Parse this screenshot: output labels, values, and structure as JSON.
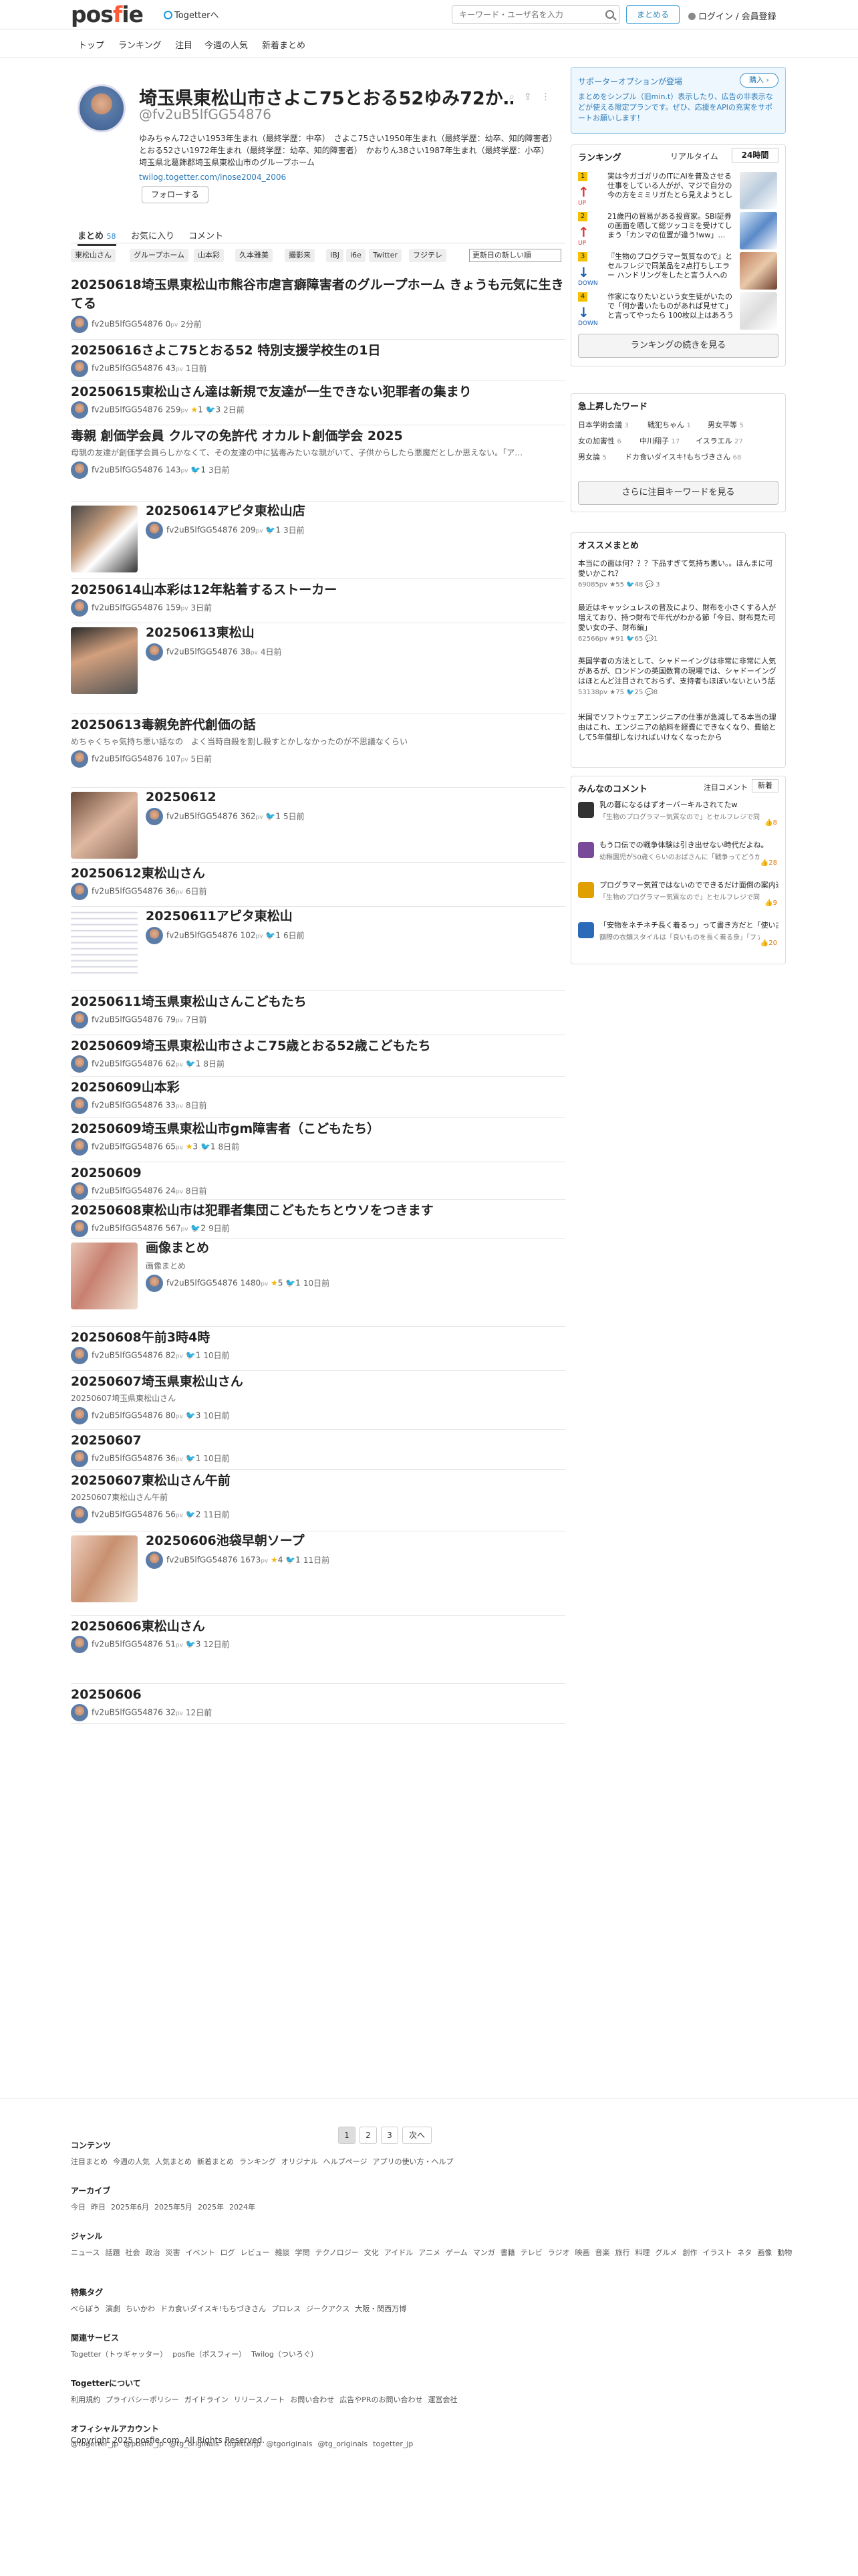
{
  "header": {
    "logo": "posfie",
    "togetter": "Togetterへ",
    "search_placeholder": "キーワード・ユーザ名を入力",
    "create_label": "まとめる",
    "login_label": "ログイン / 会員登録"
  },
  "nav": [
    "トップ",
    "ランキング",
    "注目",
    "今週の人気",
    "新着まとめ"
  ],
  "profile": {
    "name": "埼玉県東松山市さよこ75とおる52ゆみ72か…",
    "handle": "@fv2uB5lfGG54876",
    "description": "ゆみちゃん72さい1953年生まれ（最終学歴：中卒）　さよこ75さい1950年生まれ（最終学歴：幼卒、知的障害者）　とおる52さい1972年生まれ（最終学歴：幼卒、知的障害者）　かおりん38さい1987年生まれ（最終学歴：小卒）　埼玉県北葛飾郡埼玉県東松山市のグループホーム",
    "link": "twilog.togetter.com/inose2004_2006",
    "follow_label": "フォローする"
  },
  "tabs": [
    {
      "label": "まとめ",
      "count": "58"
    },
    {
      "label": "お気に入り",
      "count": ""
    },
    {
      "label": "コメント",
      "count": ""
    }
  ],
  "tags": [
    "東松山さん",
    "グループホーム",
    "山本彩",
    "久本雅美",
    "撮影来",
    "IBJ",
    "i6e",
    "Twitter",
    "フジテレ"
  ],
  "sort_label": "更新日の新しい順",
  "items": [
    {
      "title": "20250618埼玉県東松山市熊谷市虐言癖障害者のグループホーム きょうも元気に生きてる",
      "desc": "",
      "user": "fv2uB5lfGG54876",
      "views": "0",
      "unit": "pv",
      "stars": "",
      "tw": "",
      "time": "2分前"
    },
    {
      "title": "20250616さよこ75とおる52 特別支援学校生の1日",
      "desc": "",
      "user": "fv2uB5lfGG54876",
      "views": "43",
      "unit": "pv",
      "stars": "",
      "tw": "",
      "time": "1日前"
    },
    {
      "title": "20250615東松山さん達は新規で友達が一生できない犯罪者の集まり",
      "desc": "",
      "user": "fv2uB5lfGG54876",
      "views": "259",
      "unit": "pv",
      "stars": "1",
      "tw": "3",
      "time": "2日前"
    },
    {
      "title": "毒親 創価学会員 クルマの免許代 オカルト創価学会 2025",
      "desc": "母親の友達が創価学会員らしかなくて、その友達の中に猛毒みたいな親がいて、子供からしたら悪魔だとしか思えない。「ア…",
      "user": "fv2uB5lfGG54876",
      "views": "143",
      "unit": "pv",
      "stars": "",
      "tw": "1",
      "time": "3日前"
    },
    {
      "title": "20250614アピタ東松山店",
      "desc": "",
      "user": "fv2uB5lfGG54876",
      "views": "209",
      "unit": "pv",
      "stars": "",
      "tw": "1",
      "time": "3日前"
    },
    {
      "title": "20250614山本彩は12年粘着するストーカー",
      "desc": "",
      "user": "fv2uB5lfGG54876",
      "views": "159",
      "unit": "pv",
      "stars": "",
      "tw": "",
      "time": "3日前"
    },
    {
      "title": "20250613東松山",
      "desc": "",
      "user": "fv2uB5lfGG54876",
      "views": "38",
      "unit": "pv",
      "stars": "",
      "tw": "",
      "time": "4日前"
    },
    {
      "title": "20250613毒親免許代創価の話",
      "desc": "めちゃくちゃ気持ち悪い話なの　よく当時自殺を割し殺すとかしなかったのが不思議なくらい",
      "user": "fv2uB5lfGG54876",
      "views": "107",
      "unit": "pv",
      "stars": "",
      "tw": "",
      "time": "5日前"
    },
    {
      "title": "20250612",
      "desc": "",
      "user": "fv2uB5lfGG54876",
      "views": "362",
      "unit": "pv",
      "stars": "",
      "tw": "1",
      "time": "5日前"
    },
    {
      "title": "20250612東松山さん",
      "desc": "",
      "user": "fv2uB5lfGG54876",
      "views": "36",
      "unit": "pv",
      "stars": "",
      "tw": "",
      "time": "6日前"
    },
    {
      "title": "20250611アピタ東松山",
      "desc": "",
      "user": "fv2uB5lfGG54876",
      "views": "102",
      "unit": "pv",
      "stars": "",
      "tw": "1",
      "time": "6日前"
    },
    {
      "title": "20250611埼玉県東松山さんこどもたち",
      "desc": "",
      "user": "fv2uB5lfGG54876",
      "views": "79",
      "unit": "pv",
      "stars": "",
      "tw": "",
      "time": "7日前"
    },
    {
      "title": "20250609埼玉県東松山市さよこ75歳とおる52歳こどもたち",
      "desc": "",
      "user": "fv2uB5lfGG54876",
      "views": "62",
      "unit": "pv",
      "stars": "",
      "tw": "1",
      "time": "8日前"
    },
    {
      "title": "20250609山本彩",
      "desc": "",
      "user": "fv2uB5lfGG54876",
      "views": "33",
      "unit": "pv",
      "stars": "",
      "tw": "",
      "time": "8日前"
    },
    {
      "title": "20250609埼玉県東松山市gm障害者（こどもたち）",
      "desc": "",
      "user": "fv2uB5lfGG54876",
      "views": "65",
      "unit": "pv",
      "stars": "3",
      "tw": "1",
      "time": "8日前"
    },
    {
      "title": "20250609",
      "desc": "",
      "user": "fv2uB5lfGG54876",
      "views": "24",
      "unit": "pv",
      "stars": "",
      "tw": "",
      "time": "8日前"
    },
    {
      "title": "20250608東松山市は犯罪者集団こどもたちとウソをつきます",
      "desc": "",
      "user": "fv2uB5lfGG54876",
      "views": "567",
      "unit": "pv",
      "stars": "",
      "tw": "2",
      "time": "9日前"
    },
    {
      "title": "画像まとめ",
      "desc": "画像まとめ",
      "user": "fv2uB5lfGG54876",
      "views": "1480",
      "unit": "pv",
      "stars": "5",
      "tw": "1",
      "time": "10日前"
    },
    {
      "title": "20250608午前3時4時",
      "desc": "",
      "user": "fv2uB5lfGG54876",
      "views": "82",
      "unit": "pv",
      "stars": "",
      "tw": "1",
      "time": "10日前"
    },
    {
      "title": "20250607埼玉県東松山さん",
      "desc": "20250607埼玉県東松山さん",
      "user": "fv2uB5lfGG54876",
      "views": "80",
      "unit": "pv",
      "stars": "",
      "tw": "3",
      "time": "10日前"
    },
    {
      "title": "20250607",
      "desc": "",
      "user": "fv2uB5lfGG54876",
      "views": "36",
      "unit": "pv",
      "stars": "",
      "tw": "1",
      "time": "10日前"
    },
    {
      "title": "20250607東松山さん午前",
      "desc": "20250607東松山さん午前",
      "user": "fv2uB5lfGG54876",
      "views": "56",
      "unit": "pv",
      "stars": "",
      "tw": "2",
      "time": "11日前"
    },
    {
      "title": "20250606池袋早朝ソープ",
      "desc": "",
      "user": "fv2uB5lfGG54876",
      "views": "1673",
      "unit": "pv",
      "stars": "4",
      "tw": "1",
      "time": "11日前"
    },
    {
      "title": "20250606東松山さん",
      "desc": "",
      "user": "fv2uB5lfGG54876",
      "views": "51",
      "unit": "pv",
      "stars": "",
      "tw": "3",
      "time": "12日前"
    },
    {
      "title": "20250606",
      "desc": "",
      "user": "fv2uB5lfGG54876",
      "views": "32",
      "unit": "pv",
      "stars": "",
      "tw": "",
      "time": "12日前"
    }
  ],
  "pager": [
    "1",
    "2",
    "3",
    "次へ"
  ],
  "sidebar": {
    "support": {
      "title": "サポーターオプションが登場",
      "button": "購入 ›",
      "text": "まとめをシンプル（旧min.t）表示したり、広告の非表示などが使える限定プランです。ぜひ、応援をAPIの充実をサポートお願いします！"
    },
    "ranking": {
      "title": "ランキング",
      "tab_realtime": "リアルタイム",
      "tab_24h": "24時間",
      "items": [
        {
          "num": "1",
          "dir": "UP",
          "text": "実は今ガゴガリのITにAIを普及させる仕事をしている人がが、マジで自分の今の方をミミリガたとら見えようとしない七の方と思っても見合を…"
        },
        {
          "num": "2",
          "dir": "UP",
          "text": "21歳円の貿易がある投資家。SBI証券の画面を晒して総ツッコミを受けてしまう「カンマの位置が違う!ww」…"
        },
        {
          "num": "3",
          "dir": "DOWN",
          "text": "『生物のプログラマー気質なので』とセルフレジで同業品を2点打ちしエラー ハンドリングをしたと言う人への反…"
        },
        {
          "num": "4",
          "dir": "DOWN",
          "text": "作家になりたいという女生徒がいたので「何か書いたものがあれば見せて」と言ってやったら 100枚以上はあろうかという A4の紙を渡され…"
        }
      ],
      "button": "ランキングの続きを見る"
    },
    "trending": {
      "title": "急上昇したワード",
      "words": [
        {
          "w": "日本学術会議",
          "n": "3"
        },
        {
          "w": "戦犯ちゃん",
          "n": "1"
        },
        {
          "w": "男女平等",
          "n": "5"
        },
        {
          "w": "女の加害性",
          "n": "6"
        },
        {
          "w": "中川翔子",
          "n": "17"
        },
        {
          "w": "イスラエル",
          "n": "27"
        },
        {
          "w": "男女論",
          "n": "5"
        },
        {
          "w": "ドカ食いダイスキ!もちづきさん",
          "n": "68"
        }
      ],
      "button": "さらに注目キーワードを見る"
    },
    "recommend": {
      "title": "オススメまとめ",
      "items": [
        {
          "text": "本当にの面は何？？？下品すぎて気持ち悪い。。ほんまに可愛いかこれ？",
          "meta": "69085pv ★55 🐦48 💬 3"
        },
        {
          "text": "最近はキャッシュレスの普及により、財布を小さくする人が増えており、持つ財布で年代がわかる節「今日、財布見た可愛い女の子、財布編」",
          "meta": "62566pv ★91 🐦65 💬1"
        },
        {
          "text": "英国学者の方法として、シャドーイングは非常に非常に人気があるが、ロンドンの英国数育の現場では、シャドーイングはほとんど注目されておらず、支持者もほぼいないという話",
          "meta": "53138pv ★75 🐦25 💬8"
        },
        {
          "text": "米国でソフトウェアエンジニアの仕事が急減してる本当の理由はこれ、エンジニアの給料を経費にできなくなり、費給として5年償却しなければいけなくなったから",
          "meta": ""
        }
      ]
    },
    "comments": {
      "title": "みんなのコメント",
      "tab_attention": "注目コメント",
      "tab_new": "新着",
      "items": [
        {
          "title": "乳の暮になるはずオーバーキルされてたw",
          "sub": "「生物のプログラマー気質なので」とセルフレジで同…",
          "likes": "8"
        },
        {
          "title": "もう口伝での戦争体験は引き出せない時代だよね。",
          "sub": "幼稚園児が50歳くらいのおばさんに「戦争ってどうか…",
          "likes": "28"
        },
        {
          "title": "プログラマー気質ではないのでできるだけ面倒の案内通りに操作してアテークスのバグ踏まな…",
          "sub": "「生物のプログラマー気質なので」とセルフレジで同…",
          "likes": "9"
        },
        {
          "title": "「安物をネチネチ長く着るっ」って書き方だと「使い古したタオルは捨てずに雑巾にする」的な…",
          "sub": "額際の衣類スタイルは「良いものを長く着る身」「ファ…",
          "likes": "20"
        }
      ]
    }
  },
  "footer": [
    {
      "h": "コンテンツ",
      "l": [
        "注目まとめ",
        "今週の人気",
        "人気まとめ",
        "新着まとめ",
        "ランキング",
        "オリジナル",
        "ヘルプページ",
        "アプリの使い方・ヘルプ"
      ]
    },
    {
      "h": "アーカイブ",
      "l": [
        "今日",
        "昨日",
        "2025年6月",
        "2025年5月",
        "2025年",
        "2024年"
      ]
    },
    {
      "h": "ジャンル",
      "l": [
        "ニュース",
        "話題",
        "社会",
        "政治",
        "災害",
        "イベント",
        "ログ",
        "レビュー",
        "雑談",
        "学問",
        "テクノロジー",
        "文化",
        "アイドル",
        "アニメ",
        "ゲーム",
        "マンガ",
        "書籍",
        "テレビ",
        "ラジオ",
        "映画",
        "音楽",
        "旅行",
        "料理",
        "グルメ",
        "創作",
        "イラスト",
        "ネタ",
        "画像",
        "動物"
      ]
    },
    {
      "h": "特集タグ",
      "l": [
        "べらぼう",
        "演劇",
        "ちいかわ",
        "ドカ食いダイスキ!もちづきさん",
        "プロレス",
        "ジークアクス",
        "大阪・関西万博"
      ]
    },
    {
      "h": "関連サービス",
      "l": [
        "Togetter（トゥギャッター）",
        "posfie（ポスフィー）",
        "Twilog（ついろぐ）"
      ]
    },
    {
      "h": "Togetterについて",
      "l": [
        "利用規約",
        "プライバシーポリシー",
        "ガイドライン",
        "リリースノート",
        "お問い合わせ",
        "広告やPRのお問い合わせ",
        "運営会社"
      ]
    },
    {
      "h": "オフィシャルアカウント",
      "l": [
        "@togetter_jp",
        "@posfie_jp",
        "@tg_originals",
        "togetterjp",
        "@tgoriginals",
        "@tg_originals",
        "togetter_jp"
      ]
    }
  ],
  "copyright": "Copyright 2025 posfie.com. All Rights Reserved."
}
